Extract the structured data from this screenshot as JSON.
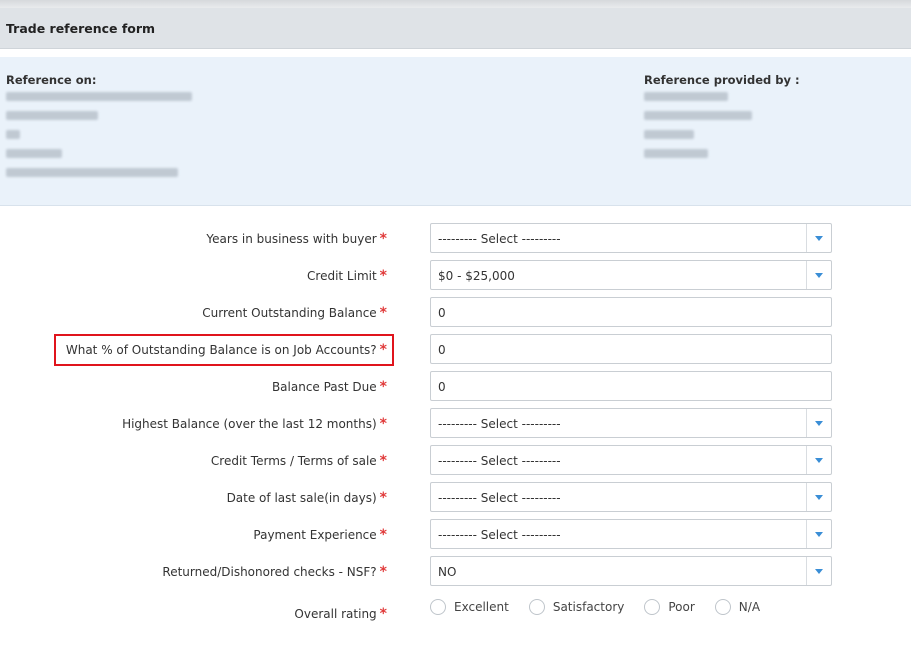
{
  "form": {
    "title": "Trade reference form"
  },
  "info": {
    "reference_on_label": "Reference on:",
    "reference_provided_by_label": "Reference provided by :"
  },
  "fields": [
    {
      "label": "Years in business with buyer",
      "value": "--------- Select ---------",
      "type": "select"
    },
    {
      "label": "Credit Limit",
      "value": "$0 - $25,000",
      "type": "select"
    },
    {
      "label": "Current Outstanding Balance",
      "value": "0",
      "type": "text"
    },
    {
      "label": "What % of Outstanding Balance is on Job Accounts?",
      "value": "0",
      "type": "text"
    },
    {
      "label": "Balance Past Due",
      "value": "0",
      "type": "text"
    },
    {
      "label": "Highest Balance (over the last 12 months)",
      "value": "--------- Select ---------",
      "type": "select"
    },
    {
      "label": "Credit Terms / Terms of sale",
      "value": "--------- Select ---------",
      "type": "select"
    },
    {
      "label": "Date of last sale(in days)",
      "value": "--------- Select ---------",
      "type": "select"
    },
    {
      "label": "Payment Experience",
      "value": "--------- Select ---------",
      "type": "select"
    },
    {
      "label": "Returned/Dishonored checks - NSF?",
      "value": "NO",
      "type": "select"
    }
  ],
  "rating": {
    "label": "Overall rating",
    "options": [
      "Excellent",
      "Satisfactory",
      "Poor",
      "N/A"
    ]
  },
  "required_marker": "*",
  "colors": {
    "required": "#e03a3a",
    "highlight": "#e0141c",
    "dropdown_arrow": "#3a8ed6"
  }
}
